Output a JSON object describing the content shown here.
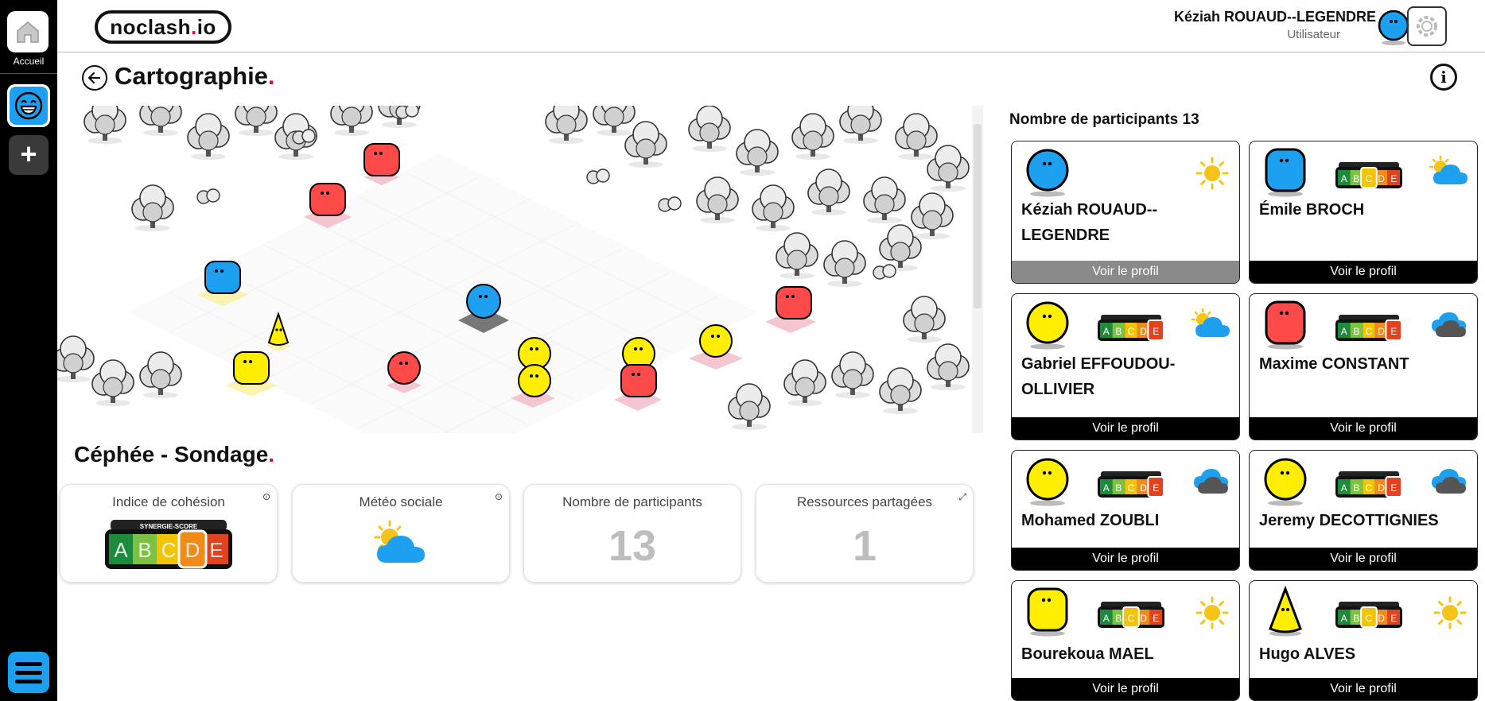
{
  "app": {
    "logo_text": "noclash",
    "logo_dot": ".",
    "logo_suffix": "io",
    "home_label": "Accueil",
    "add_label": "+"
  },
  "user": {
    "name": "Kéziah ROUAUD--LEGENDRE",
    "dot": ".",
    "role": "Utilisateur"
  },
  "page": {
    "title": "Cartographie",
    "title_dot": ".",
    "info": "i"
  },
  "project": {
    "title": "Céphée - Sondage",
    "title_dot": ".",
    "cards": [
      {
        "label": "Indice de cohésion",
        "kind": "score",
        "score": "D",
        "corner_icon": "target-icon"
      },
      {
        "label": "Météo sociale",
        "kind": "weather",
        "weather": "partly-cloudy",
        "corner_icon": "target-icon"
      },
      {
        "label": "Nombre de participants",
        "kind": "number",
        "value": "13"
      },
      {
        "label": "Ressources partagées",
        "kind": "number",
        "value": "1",
        "corner_icon": "expand-icon"
      }
    ]
  },
  "participants": {
    "label": "Nombre de participants",
    "count": "13",
    "button_label": "Voir le profil",
    "items": [
      {
        "name_line1": "Kéziah ROUAUD--",
        "name_line2": "LEGENDRE",
        "color": "#1ea0f0",
        "shape": "round",
        "score": null,
        "weather": "sunny",
        "current": true
      },
      {
        "name_line1": "Émile BROCH",
        "name_line2": "",
        "color": "#1ea0f0",
        "shape": "square",
        "score": "C",
        "weather": "partly-cloudy-blue",
        "current": false
      },
      {
        "name_line1": "Gabriel EFFOUDOU-",
        "name_line2": "OLLIVIER",
        "color": "#ffee00",
        "shape": "round",
        "score": "E",
        "weather": "partly-cloudy-blue",
        "current": false
      },
      {
        "name_line1": "Maxime CONSTANT",
        "name_line2": "",
        "color": "#ff4a4a",
        "shape": "square",
        "score": "E",
        "weather": "cloudy-dark",
        "current": false
      },
      {
        "name_line1": "Mohamed ZOUBLI",
        "name_line2": "",
        "color": "#ffee00",
        "shape": "round",
        "score": "E",
        "weather": "cloudy-dark",
        "current": false
      },
      {
        "name_line1": "Jeremy DECOTTIGNIES",
        "name_line2": "",
        "color": "#ffee00",
        "shape": "round",
        "score": "E",
        "weather": "cloudy-dark",
        "current": false
      },
      {
        "name_line1": "Bourekoua MAEL",
        "name_line2": "",
        "color": "#ffee00",
        "shape": "square",
        "score": "C",
        "weather": "sunny",
        "current": false
      },
      {
        "name_line1": "Hugo ALVES",
        "name_line2": "",
        "color": "#ffee00",
        "shape": "cone",
        "score": "C",
        "weather": "sunny",
        "current": false
      }
    ]
  },
  "score_badge": {
    "header": "SYNERGIE-SCORE",
    "letters": [
      "A",
      "B",
      "C",
      "D",
      "E"
    ],
    "colors": [
      "#1e8a3c",
      "#7cc242",
      "#f2c500",
      "#f08a1a",
      "#e0431e"
    ]
  },
  "colors": {
    "accent": "#e6005c",
    "brand_blue": "#1ea0f0",
    "yellow": "#ffee00",
    "red": "#ff4a4a"
  }
}
